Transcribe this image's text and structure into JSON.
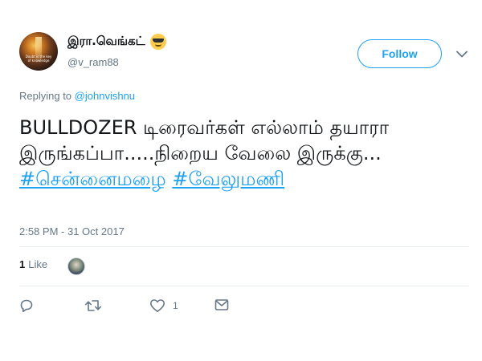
{
  "author": {
    "display_name": "இரா.வெங்கட்",
    "emoji_icon": "sunglasses-emoji-icon",
    "handle": "@v_ram88",
    "avatar_text": "Doubt is the key of knowledge"
  },
  "follow_button": {
    "label": "Follow"
  },
  "menu": {
    "icon": "chevron-down-icon"
  },
  "reply_context": {
    "prefix": "Replying to",
    "mention": "@johnvishnu"
  },
  "tweet": {
    "text": "BULLDOZER டிரைவர்கள் எல்லாம் தயாரா இருங்கப்பா.....நிறைய வேலை இருக்கு...",
    "hashtags": [
      "#சென்னைமழை",
      "#வேலுமணி"
    ],
    "timestamp": "2:58 PM - 31 Oct 2017"
  },
  "likes": {
    "count": "1",
    "label": "Like"
  },
  "actions": {
    "reply": {
      "icon": "reply-icon"
    },
    "retweet": {
      "icon": "retweet-icon"
    },
    "like": {
      "icon": "heart-icon",
      "count": "1"
    },
    "dm": {
      "icon": "envelope-icon"
    }
  },
  "colors": {
    "accent": "#1da1f2",
    "secondary_text": "#657786",
    "primary_text": "#14171a",
    "divider": "#e6ecf0"
  }
}
